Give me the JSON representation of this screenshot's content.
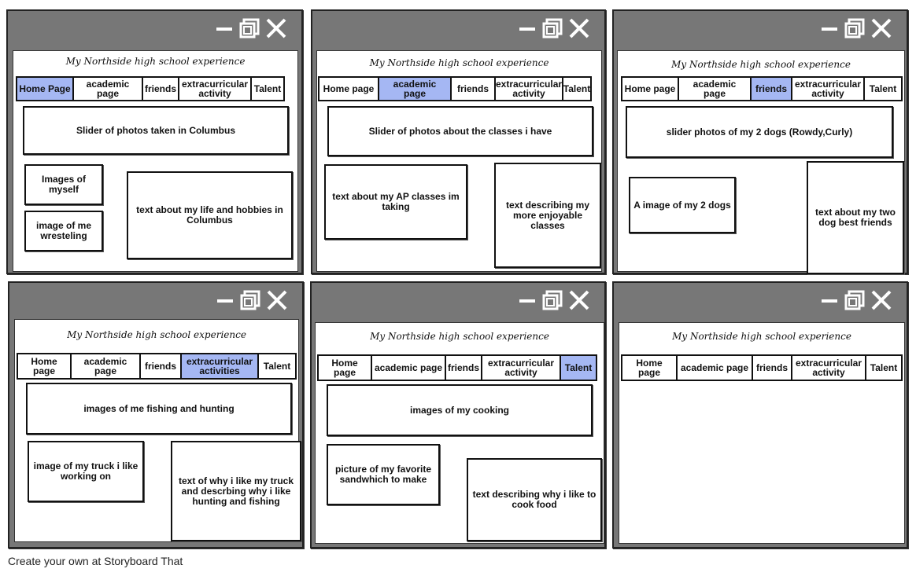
{
  "site_title": "My Northside high school experience",
  "footer": "Create your own at Storyboard That",
  "panels": [
    {
      "tabs": [
        "Home Page",
        "academic page",
        "friends",
        "extracurricular activity",
        "Talent"
      ],
      "active": 0,
      "boxes": [
        "Slider of photos taken in Columbus",
        "Images of myself",
        "image of me wresteling",
        "text about my life and hobbies in Columbus"
      ]
    },
    {
      "tabs": [
        "Home page",
        "academic page",
        "friends",
        "extracurricular activity",
        "Talent"
      ],
      "active": 1,
      "boxes": [
        "Slider of photos about the classes i have",
        "text about my AP classes im taking",
        "text describing my more enjoyable classes"
      ]
    },
    {
      "tabs": [
        "Home page",
        "academic page",
        "friends",
        "extracurricular activity",
        "Talent"
      ],
      "active": 2,
      "boxes": [
        "slider photos of my 2 dogs (Rowdy,Curly)",
        "A image of my 2 dogs",
        "text about my two dog best friends"
      ]
    },
    {
      "tabs": [
        "Home page",
        "academic page",
        "friends",
        "extracurricular activities",
        "Talent"
      ],
      "active": 3,
      "boxes": [
        "images of me fishing and hunting",
        "image of my truck i like working on",
        "text of why i like my truck and descrbing why i like hunting and fishing"
      ]
    },
    {
      "tabs": [
        "Home page",
        "academic page",
        "friends",
        "extracurricular activity",
        "Talent"
      ],
      "active": 4,
      "boxes": [
        "images of my cooking",
        "picture of my favorite sandwhich to make",
        "text describing why i like to cook food"
      ]
    },
    {
      "tabs": [
        "Home page",
        "academic page",
        "friends",
        "extracurricular activity",
        "Talent"
      ],
      "active": -1,
      "boxes": []
    }
  ]
}
